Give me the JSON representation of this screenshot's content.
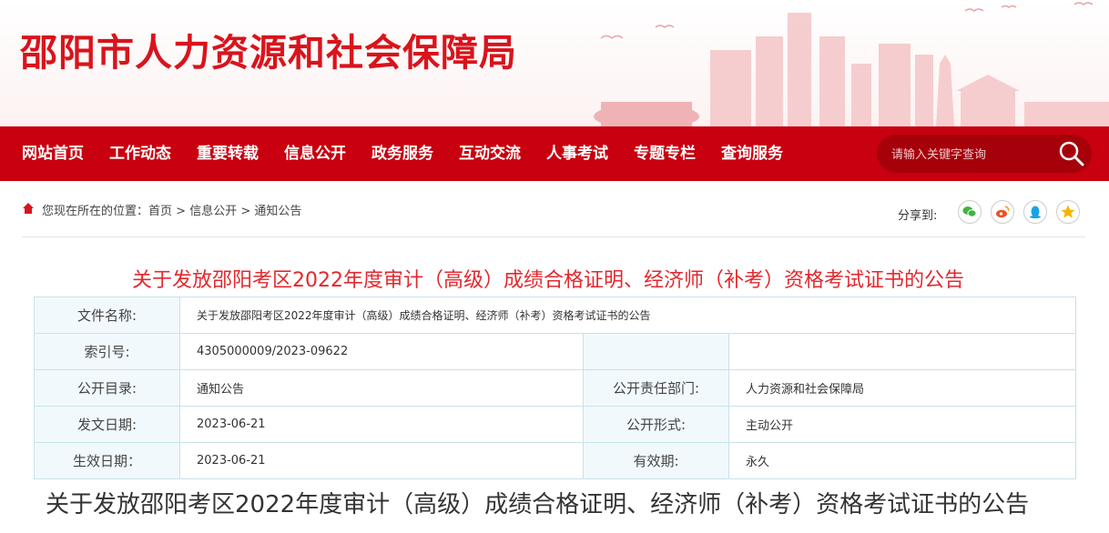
{
  "header": {
    "site_title": "邵阳市人力资源和社会保障局"
  },
  "nav": {
    "items": [
      "网站首页",
      "工作动态",
      "重要转载",
      "信息公开",
      "政务服务",
      "互动交流",
      "人事考试",
      "专题专栏",
      "查询服务"
    ]
  },
  "search": {
    "placeholder": "请输入关键字查询"
  },
  "breadcrumb": {
    "prefix": "您现在所在的位置：",
    "home": "首页",
    "sep": " > ",
    "level1": "信息公开",
    "level2": "通知公告"
  },
  "share": {
    "label": "分享到:",
    "icons": [
      "wechat-icon",
      "weibo-icon",
      "qq-icon",
      "qzone-icon"
    ]
  },
  "article": {
    "title": "关于发放邵阳考区2022年度审计（高级）成绩合格证明、经济师（补考）资格考试证书的公告",
    "heading": "关于发放邵阳考区2022年度审计（高级）成绩合格证明、经济师（补考）资格考试证书的公告"
  },
  "info": {
    "file_name_label": "文件名称:",
    "file_name_value": "关于发放邵阳考区2022年度审计（高级）成绩合格证明、经济师（补考）资格考试证书的公告",
    "index_label": "索引号:",
    "index_value": "4305000009/2023-09622",
    "catalog_label": "公开目录:",
    "catalog_value": "通知公告",
    "dept_label": "公开责任部门:",
    "dept_value": "人力资源和社会保障局",
    "issue_label": "发文日期:",
    "issue_value": "2023-06-21",
    "form_label": "公开形式:",
    "form_value": "主动公开",
    "effective_label": "生效日期：",
    "effective_value": "2023-06-21",
    "validity_label": "有效期:",
    "validity_value": "永久"
  },
  "colors": {
    "brand_red": "#d8141c",
    "nav_red": "#c8000f",
    "title_red": "#e3282e"
  }
}
